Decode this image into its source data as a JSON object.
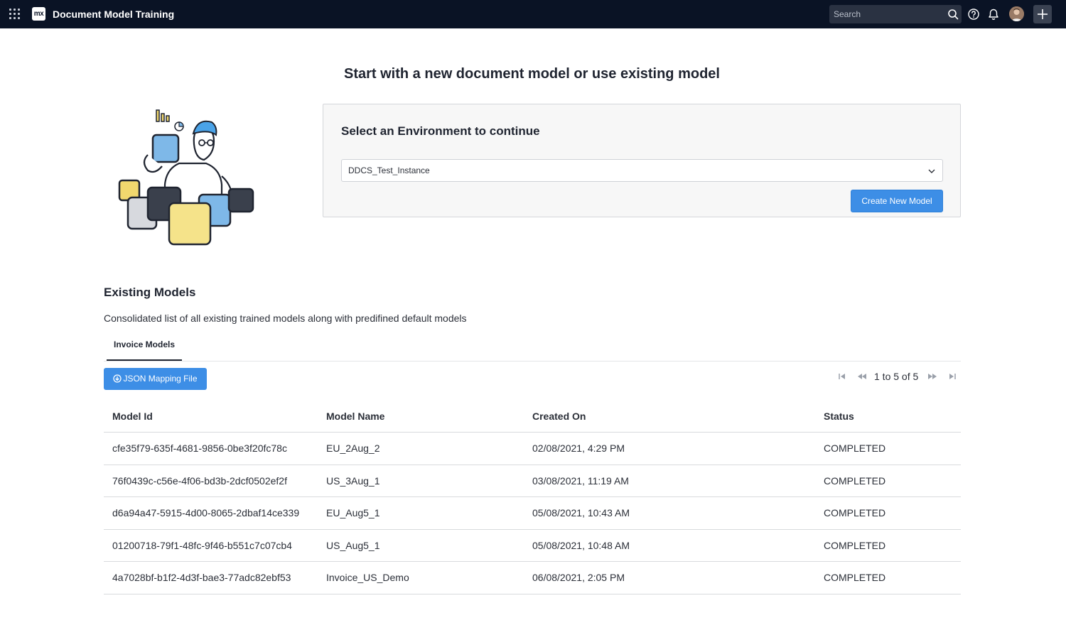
{
  "app": {
    "title": "Document Model Training",
    "logo_text": "mx"
  },
  "topbar": {
    "search_placeholder": "Search",
    "icons": [
      "apps-grid-icon",
      "search-icon",
      "help-icon",
      "bell-icon",
      "avatar",
      "plus-icon"
    ]
  },
  "main": {
    "headline": "Start with a new document model or use existing model"
  },
  "environment": {
    "title": "Select an Environment to continue",
    "selected": "DDCS_Test_Instance",
    "create_button": "Create New Model"
  },
  "existing_models": {
    "title": "Existing Models",
    "description": "Consolidated list of all existing trained models along with predifined default models",
    "tabs": [
      "Invoice Models"
    ],
    "json_button": "JSON Mapping File",
    "pagination": "1 to 5 of 5",
    "columns": [
      "Model Id",
      "Model Name",
      "Created On",
      "Status"
    ],
    "rows": [
      [
        "cfe35f79-635f-4681-9856-0be3f20fc78c",
        "EU_2Aug_2",
        "02/08/2021, 4:29 PM",
        "COMPLETED"
      ],
      [
        "76f0439c-c56e-4f06-bd3b-2dcf0502ef2f",
        "US_3Aug_1",
        "03/08/2021, 11:19 AM",
        "COMPLETED"
      ],
      [
        "d6a94a47-5915-4d00-8065-2dbaf14ce339",
        "EU_Aug5_1",
        "05/08/2021, 10:43 AM",
        "COMPLETED"
      ],
      [
        "01200718-79f1-48fc-9f46-b551c7c07cb4",
        "US_Aug5_1",
        "05/08/2021, 10:48 AM",
        "COMPLETED"
      ],
      [
        "4a7028bf-b1f2-4d3f-bae3-77adc82ebf53",
        "Invoice_US_Demo",
        "06/08/2021, 2:05 PM",
        "COMPLETED"
      ]
    ]
  },
  "colors": {
    "topbar_bg": "#0a1325",
    "primary_button": "#3d8ee6",
    "panel_bg": "#f7f7f7"
  }
}
